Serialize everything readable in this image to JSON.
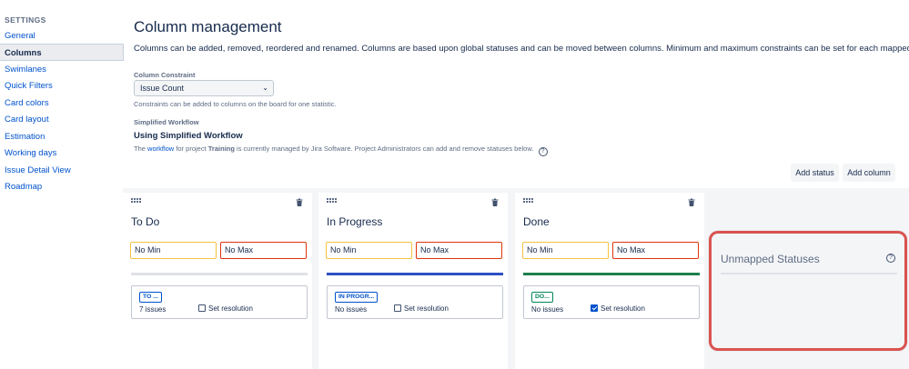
{
  "sidebar": {
    "heading": "SETTINGS",
    "items": [
      {
        "label": "General"
      },
      {
        "label": "Columns"
      },
      {
        "label": "Swimlanes"
      },
      {
        "label": "Quick Filters"
      },
      {
        "label": "Card colors"
      },
      {
        "label": "Card layout"
      },
      {
        "label": "Estimation"
      },
      {
        "label": "Working days"
      },
      {
        "label": "Issue Detail View"
      },
      {
        "label": "Roadmap"
      }
    ]
  },
  "main": {
    "title": "Column management",
    "description": "Columns can be added, removed, reordered and renamed. Columns are based upon global statuses and can be moved between columns. Minimum and maximum constraints can be set for each mapped column.",
    "constraint_label": "Column Constraint",
    "constraint_value": "Issue Count",
    "constraint_help": "Constraints can be added to columns on the board for one statistic.",
    "workflow_label": "Simplified Workflow",
    "workflow_title": "Using Simplified Workflow",
    "workflow_desc_pre": "The",
    "workflow_link": "workflow",
    "workflow_desc_mid": "for project",
    "workflow_project": "Training",
    "workflow_desc_post": "is currently managed by Jira Software. Project Administrators can add and remove statuses below.",
    "help_glyph": "?",
    "add_status_label": "Add status",
    "add_column_label": "Add column"
  },
  "columns": [
    {
      "name": "To Do",
      "min": "No Min",
      "max": "No Max",
      "status": "TO ...",
      "issues": "7 issues",
      "resolution": "Set resolution",
      "color": "#dfe1e6",
      "lozenge_color": "#0052cc",
      "checked": false
    },
    {
      "name": "In Progress",
      "min": "No Min",
      "max": "No Max",
      "status": "IN PROGR...",
      "issues": "No issues",
      "resolution": "Set resolution",
      "color": "#2e4fc3",
      "lozenge_color": "#0052cc",
      "checked": false
    },
    {
      "name": "Done",
      "min": "No Min",
      "max": "No Max",
      "status": "DO...",
      "issues": "No issues",
      "resolution": "Set resolution",
      "color": "#1f7f4c",
      "lozenge_color": "#00875a",
      "checked": true
    }
  ],
  "unmapped": {
    "title": "Unmapped Statuses",
    "highlight_color": "#d9534f"
  },
  "icons": {
    "drag": "drag-handle-icon",
    "trash": "trash-icon",
    "help": "question-circle-icon"
  }
}
